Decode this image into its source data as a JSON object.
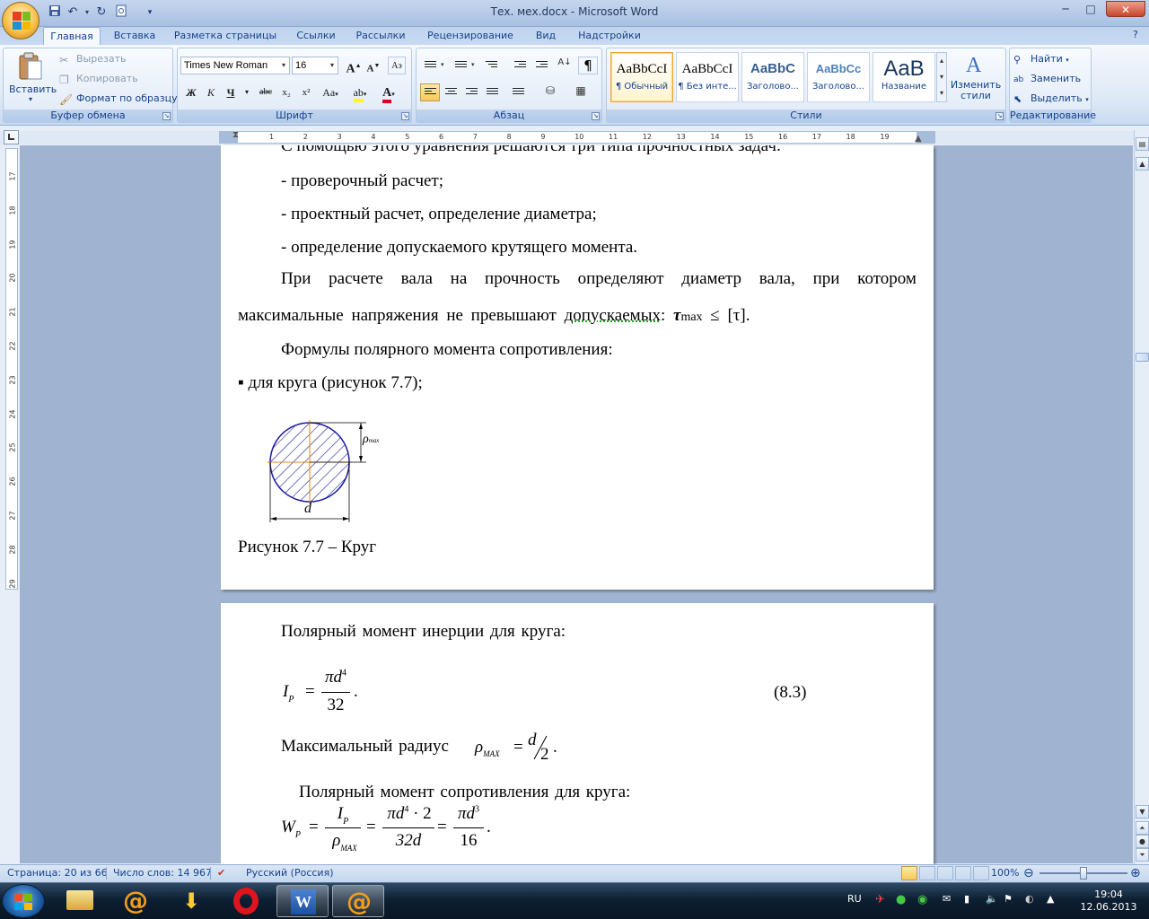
{
  "window": {
    "title": "Тех. мех.docx - Microsoft Word",
    "minimize_glyph": "─",
    "maximize_glyph": "□",
    "close_glyph": "✕",
    "qat_undo": "↶",
    "qat_redo": "↻",
    "qat_more": "▾"
  },
  "tabs": [
    "Главная",
    "Вставка",
    "Разметка страницы",
    "Ссылки",
    "Рассылки",
    "Рецензирование",
    "Вид",
    "Надстройки"
  ],
  "active_tab": "Главная",
  "ribbon": {
    "clipboard": {
      "label": "Буфер обмена",
      "paste": "Вставить",
      "cut": "Вырезать",
      "copy": "Копировать",
      "format_painter": "Формат по образцу"
    },
    "font": {
      "label": "Шрифт",
      "font_name": "Times New Roman",
      "font_size": "16",
      "bold": "Ж",
      "italic": "К",
      "underline": "Ч",
      "strike": "abc",
      "subscript": "x₂",
      "superscript": "x²",
      "change_case": "Aa",
      "grow": "A",
      "shrink": "A"
    },
    "paragraph": {
      "label": "Абзац",
      "pilcrow": "¶"
    },
    "styles": {
      "label": "Стили",
      "items": [
        {
          "sample": "AaBbCcI",
          "name": "¶ Обычный"
        },
        {
          "sample": "AaBbCcI",
          "name": "¶ Без инте..."
        },
        {
          "sample": "AaBbC",
          "name": "Заголово..."
        },
        {
          "sample": "AaBbCc",
          "name": "Заголово..."
        },
        {
          "sample": "AaB",
          "name": "Название"
        }
      ],
      "change_styles": "Изменить стили"
    },
    "editing": {
      "label": "Редактирование",
      "find": "Найти",
      "replace": "Заменить",
      "select": "Выделить"
    }
  },
  "ruler": {
    "h_numbers": [
      "1",
      "2",
      "3",
      "4",
      "5",
      "6",
      "7",
      "8",
      "9",
      "10",
      "11",
      "12",
      "13",
      "14",
      "15",
      "16",
      "17",
      "18",
      "19"
    ],
    "v_numbers": [
      "17",
      "18",
      "19",
      "20",
      "21",
      "22",
      "23",
      "24",
      "25",
      "26",
      "27",
      "28",
      "29"
    ]
  },
  "page1": {
    "partial_line": "С помощью этого уравнения решаются три типа прочностных задач:",
    "items": [
      "- проверочный расчет;",
      "- проектный расчет, определение диаметра;",
      "- определение допускаемого крутящего момента."
    ],
    "para1_line1_words": [
      "При",
      "расчете",
      "вала",
      "на",
      "прочность",
      "определяют",
      "диаметр",
      "вала,",
      "при",
      "котором"
    ],
    "para1_line2": "максимальные напряжения не превышают",
    "para1_underlined": "допускаемых",
    "para1_tau": "τ",
    "para1_max": "max",
    "para1_rest": " ≤ [τ].",
    "formulas_heading": "Формулы полярного момента сопротивления:",
    "bullet": "▪ для круга (рисунок 7.7);",
    "figure_rho": "ρ",
    "figure_rho_sub": "max",
    "figure_d": "d",
    "caption": "Рисунок 7.7 – Круг"
  },
  "page2": {
    "line1": "Полярный момент инерции для круга:",
    "eq1": {
      "I": "I",
      "sub": "P",
      "num": "πd",
      "num_exp": "4",
      "den": "32",
      "number": "(8.3)"
    },
    "line2": "Максимальный радиус",
    "eq2": {
      "rho": "ρ",
      "sub": "MAX",
      "num": "d",
      "den": "2"
    },
    "line3": "Полярный момент сопротивления для круга:",
    "eq3": {
      "W": "W",
      "sub": "P",
      "f1_num": "I",
      "f1_num_sub": "P",
      "f1_den": "ρ",
      "f1_den_sub": "MAX",
      "f2_num": "πd",
      "f2_num_exp": "4",
      "f2_num_tail": " · 2",
      "f2_den": "32d",
      "f3_num": "πd",
      "f3_num_exp": "3",
      "f3_den": "16"
    }
  },
  "status": {
    "page": "Страница: 20 из 66",
    "words": "Число слов: 14 967",
    "language": "Русский (Россия)",
    "zoom": "100%",
    "zoom_level_percent": 100
  },
  "taskbar": {
    "lang": "RU",
    "time": "19:04",
    "date": "12.06.2013"
  },
  "colors": {
    "accent": "#15428b",
    "active_button": "#f9c85a",
    "hatch": "#1a1aa0",
    "axis": "#e08a1a"
  }
}
